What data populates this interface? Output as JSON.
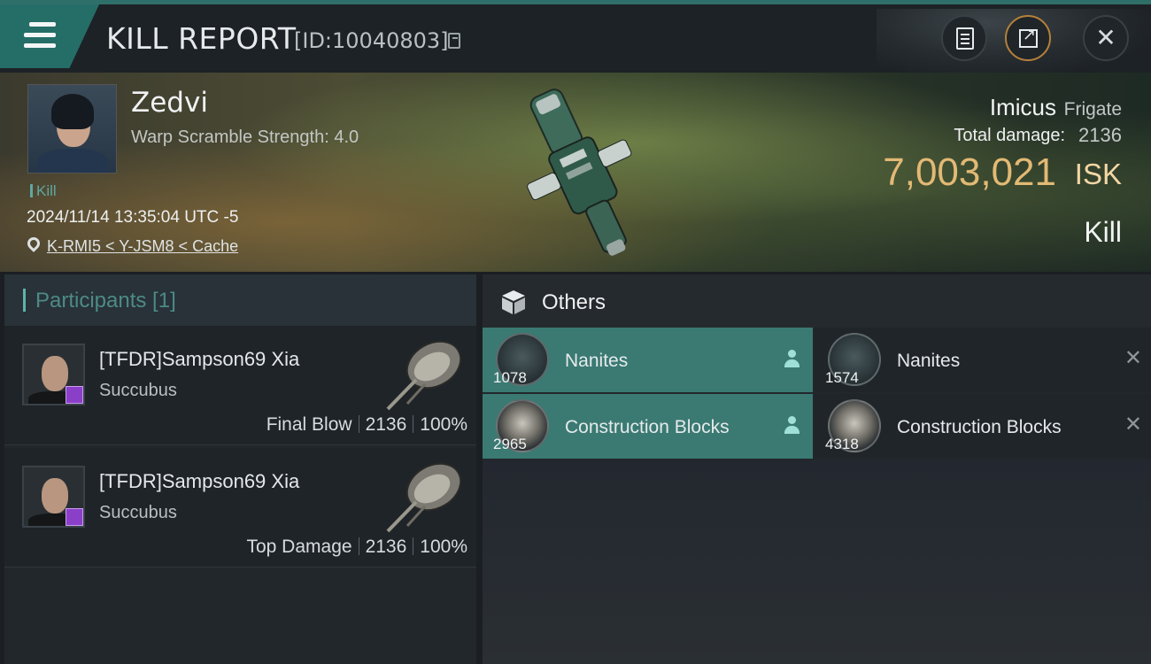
{
  "header": {
    "title": "KILL REPORT",
    "report_id": "[ID:10040803]"
  },
  "victim": {
    "name": "Zedvi",
    "warp_scramble": "Warp Scramble Strength: 4.0",
    "tag": "Kill",
    "datetime": "2024/11/14 13:35:04 UTC -5",
    "location": "K-RMI5 < Y-JSM8 < Cache"
  },
  "summary": {
    "ship_name": "Imicus",
    "ship_class": "Frigate",
    "total_damage_label": "Total damage:",
    "total_damage": "2136",
    "isk_value": "7,003,021",
    "isk_unit": "ISK",
    "result": "Kill"
  },
  "participants": {
    "title": "Participants [1]",
    "rows": [
      {
        "name": "[TFDR]Sampson69 Xia",
        "ship": "Succubus",
        "role": "Final Blow",
        "damage": "2136",
        "percent": "100%"
      },
      {
        "name": "[TFDR]Sampson69 Xia",
        "ship": "Succubus",
        "role": "Top Damage",
        "damage": "2136",
        "percent": "100%"
      }
    ]
  },
  "others": {
    "title": "Others",
    "items": [
      {
        "name": "Nanites",
        "qty": "1078",
        "status": "dropped"
      },
      {
        "name": "Nanites",
        "qty": "1574",
        "status": "destroyed"
      },
      {
        "name": "Construction Blocks",
        "qty": "2965",
        "status": "dropped"
      },
      {
        "name": "Construction Blocks",
        "qty": "4318",
        "status": "destroyed"
      }
    ]
  },
  "colors": {
    "accent": "#256e67",
    "drop_bg": "#3a7a73",
    "isk": "#e2b974",
    "corp_badge": "#8a3fc9"
  },
  "icons": [
    "menu-icon",
    "copy-icon",
    "clipboard-icon",
    "share-icon",
    "close-icon",
    "location-pin-icon",
    "cube-icon",
    "person-icon",
    "x-icon"
  ]
}
